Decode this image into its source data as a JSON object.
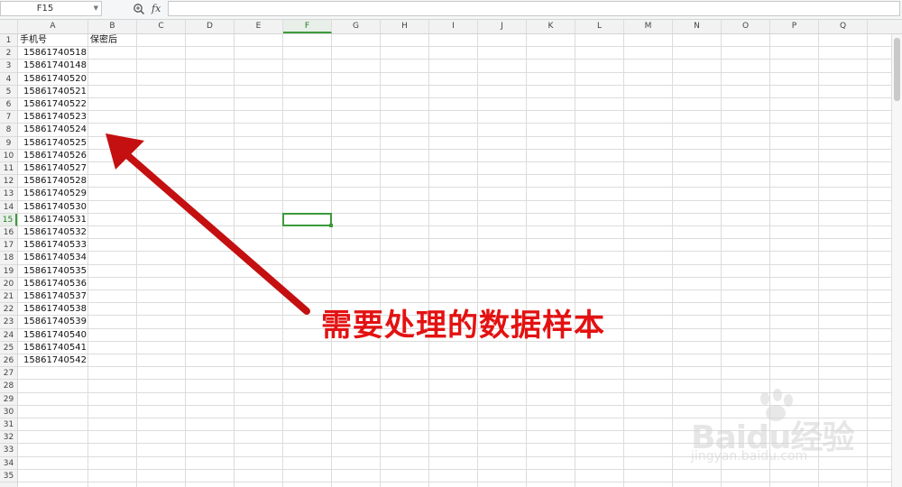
{
  "formula_bar": {
    "name_box": "F15",
    "fx_label": "fx",
    "formula": ""
  },
  "columns": [
    "A",
    "B",
    "C",
    "D",
    "E",
    "F",
    "G",
    "H",
    "I",
    "J",
    "K",
    "L",
    "M",
    "N",
    "O",
    "P",
    "Q"
  ],
  "selected_column": "F",
  "rows": [
    "1",
    "2",
    "3",
    "4",
    "5",
    "6",
    "7",
    "8",
    "9",
    "10",
    "11",
    "12",
    "13",
    "14",
    "15",
    "16",
    "17",
    "18",
    "19",
    "20",
    "21",
    "22",
    "23",
    "24",
    "25",
    "26",
    "27",
    "28",
    "29",
    "30",
    "31",
    "32",
    "33",
    "34",
    "35"
  ],
  "selected_row": "15",
  "headers": {
    "A1": "手机号",
    "B1": "保密后"
  },
  "column_a_values": [
    "15861740518",
    "15861740148",
    "15861740520",
    "15861740521",
    "15861740522",
    "15861740523",
    "15861740524",
    "15861740525",
    "15861740526",
    "15861740527",
    "15861740528",
    "15861740529",
    "15861740530",
    "15861740531",
    "15861740532",
    "15861740533",
    "15861740534",
    "15861740535",
    "15861740536",
    "15861740537",
    "15861740538",
    "15861740539",
    "15861740540",
    "15861740541",
    "15861740542"
  ],
  "annotation": {
    "text": "需要处理的数据样本",
    "color": "#e31212"
  },
  "watermark": {
    "logo": "Baidu经验",
    "url": "jingyan.baidu.com"
  },
  "colors": {
    "selection": "#3c9a3c",
    "gridline": "#dcdcdc"
  }
}
